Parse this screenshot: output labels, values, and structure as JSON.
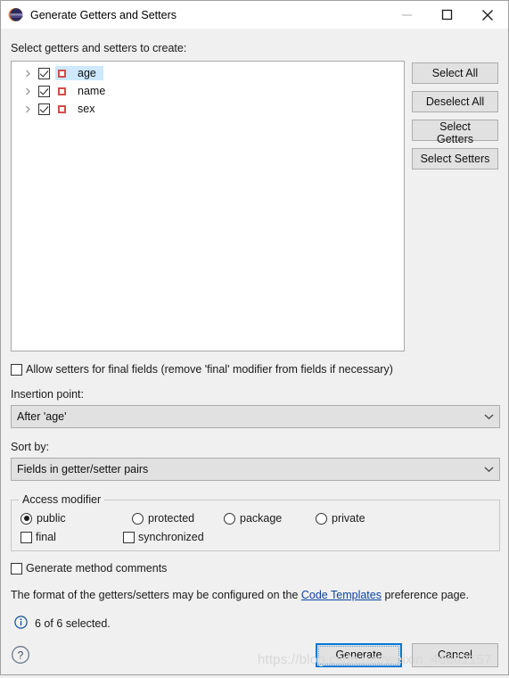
{
  "window": {
    "title": "Generate Getters and Setters",
    "app_icon": "eclipse-icon",
    "minimize_label": "—",
    "maximize_label": "☐",
    "close_label": "✕"
  },
  "main": {
    "select_label": "Select getters and setters to create:",
    "tree_items": [
      {
        "label": "age",
        "checked": true,
        "selected": true,
        "expandable": true,
        "icon": "private-field-icon"
      },
      {
        "label": "name",
        "checked": true,
        "selected": false,
        "expandable": true,
        "icon": "private-field-icon"
      },
      {
        "label": "sex",
        "checked": true,
        "selected": false,
        "expandable": true,
        "icon": "private-field-icon"
      }
    ],
    "side_buttons": [
      {
        "label": "Select All"
      },
      {
        "label": "Deselect All"
      },
      {
        "label": "Select Getters"
      },
      {
        "label": "Select Setters"
      }
    ],
    "allow_final_setters": {
      "label": "Allow setters for final fields (remove 'final' modifier from fields if necessary)",
      "checked": false
    },
    "insertion_point": {
      "label": "Insertion point:",
      "value": "After 'age'"
    },
    "sort_by": {
      "label": "Sort by:",
      "value": "Fields in getter/setter pairs"
    },
    "access_modifier": {
      "legend": "Access modifier",
      "radios": [
        {
          "label": "public",
          "selected": true
        },
        {
          "label": "protected",
          "selected": false
        },
        {
          "label": "package",
          "selected": false
        },
        {
          "label": "private",
          "selected": false
        }
      ],
      "checkboxes": [
        {
          "label": "final",
          "checked": false
        },
        {
          "label": "synchronized",
          "checked": false
        }
      ]
    },
    "generate_comments": {
      "label": "Generate method comments",
      "checked": false
    },
    "hint_prefix": "The format of the getters/setters may be configured on the ",
    "hint_link": "Code Templates",
    "hint_suffix": " preference page.",
    "status": {
      "icon": "info-icon",
      "text": "6 of 6 selected."
    }
  },
  "footer": {
    "help_icon": "help-icon",
    "generate_label": "Generate",
    "cancel_label": "Cancel"
  },
  "watermark": "https://blog.csdn.net/weixin_46662157",
  "colors": {
    "accent": "#0078d7",
    "link": "#0b44a0",
    "selection": "#cde8ff",
    "field_icon": "#d64b4b",
    "dialog_bg": "#f0f0f0"
  }
}
